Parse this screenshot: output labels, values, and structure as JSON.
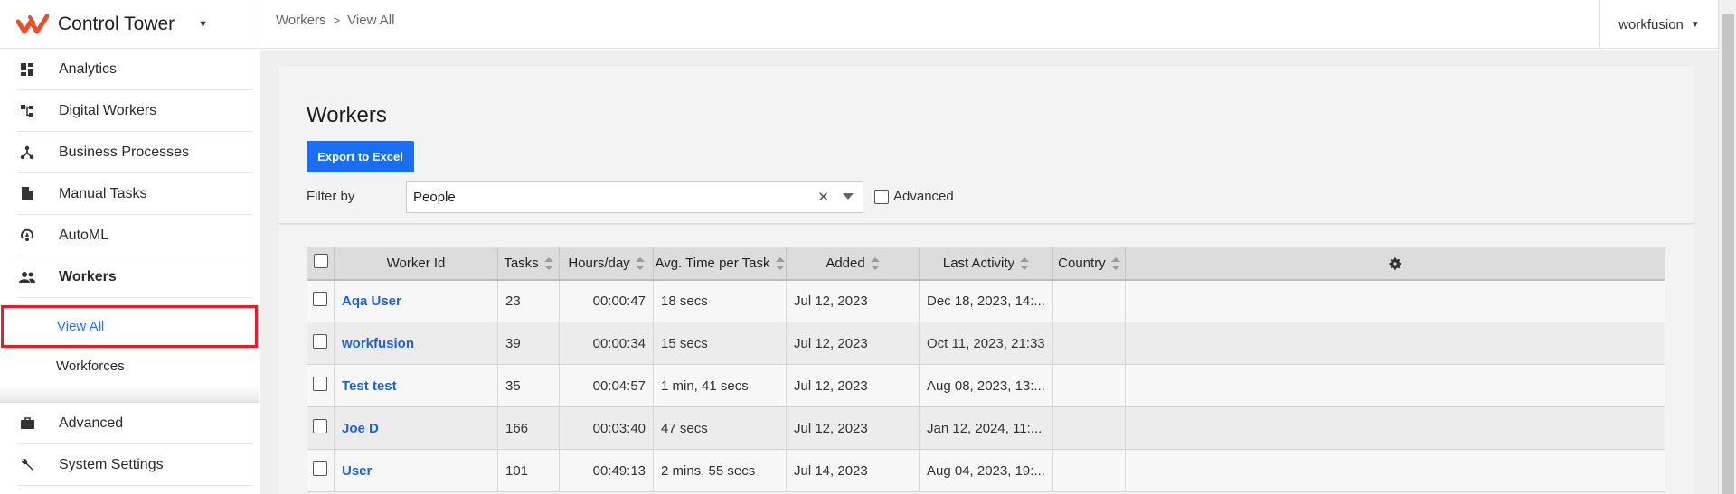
{
  "app": {
    "title": "Control Tower",
    "brand_color": "#e8502b"
  },
  "sidebar": {
    "items": [
      {
        "label": "Analytics",
        "icon": "dashboard-icon"
      },
      {
        "label": "Digital Workers",
        "icon": "hierarchy-icon"
      },
      {
        "label": "Business Processes",
        "icon": "process-icon"
      },
      {
        "label": "Manual Tasks",
        "icon": "document-icon"
      },
      {
        "label": "AutoML",
        "icon": "automl-icon"
      },
      {
        "label": "Workers",
        "icon": "people-icon"
      }
    ],
    "sub_items": [
      {
        "label": "View All"
      },
      {
        "label": "Workforces"
      }
    ],
    "bottom_items": [
      {
        "label": "Advanced",
        "icon": "briefcase-icon"
      },
      {
        "label": "System Settings",
        "icon": "wrench-icon"
      }
    ]
  },
  "header": {
    "breadcrumb": [
      "Workers",
      "View All"
    ],
    "user": "workfusion"
  },
  "main": {
    "title": "Workers",
    "export_label": "Export to Excel",
    "filter_label": "Filter by",
    "filter_value": "People",
    "advanced_label": "Advanced"
  },
  "table": {
    "columns": [
      "Worker Id",
      "Tasks",
      "Hours/day",
      "Avg. Time per Task",
      "Added",
      "Last Activity",
      "Country"
    ],
    "rows": [
      {
        "worker": "Aqa User",
        "tasks": "23",
        "hours": "00:00:47",
        "avg": "18 secs",
        "added": "Jul 12, 2023",
        "last": "Dec 18, 2023, 14:...",
        "country": ""
      },
      {
        "worker": "workfusion",
        "tasks": "39",
        "hours": "00:00:34",
        "avg": "15 secs",
        "added": "Jul 12, 2023",
        "last": "Oct 11, 2023, 21:33",
        "country": ""
      },
      {
        "worker": "Test test",
        "tasks": "35",
        "hours": "00:04:57",
        "avg": "1 min, 41 secs",
        "added": "Jul 12, 2023",
        "last": "Aug 08, 2023, 13:...",
        "country": ""
      },
      {
        "worker": "Joe D",
        "tasks": "166",
        "hours": "00:03:40",
        "avg": "47 secs",
        "added": "Jul 12, 2023",
        "last": "Jan 12, 2024, 11:...",
        "country": ""
      },
      {
        "worker": "User",
        "tasks": "101",
        "hours": "00:49:13",
        "avg": "2 mins, 55 secs",
        "added": "Jul 14, 2023",
        "last": "Aug 04, 2023, 19:...",
        "country": ""
      }
    ]
  }
}
